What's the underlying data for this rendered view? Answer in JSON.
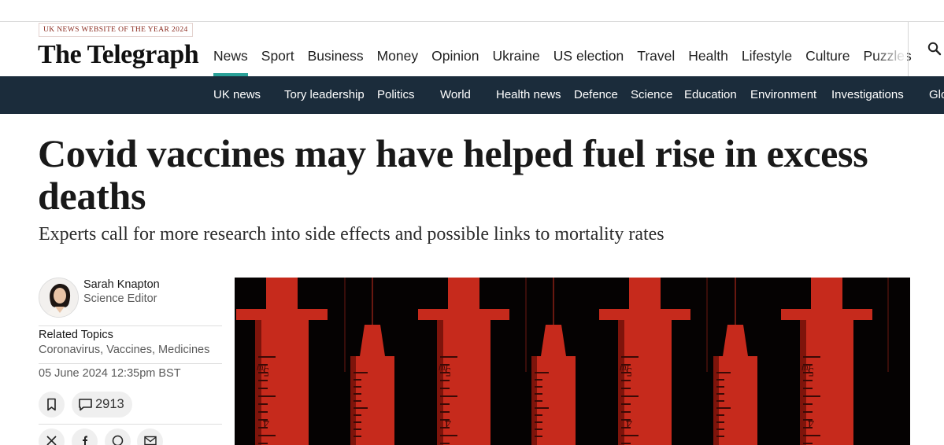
{
  "masthead": {
    "award": "UK NEWS WEBSITE OF THE YEAR 2024",
    "logo": "The Telegraph"
  },
  "primary_nav": {
    "items": [
      "News",
      "Sport",
      "Business",
      "Money",
      "Opinion",
      "Ukraine",
      "US election",
      "Travel",
      "Health",
      "Lifestyle",
      "Culture",
      "Puzzles"
    ],
    "active": "News",
    "accent": "#2aa198"
  },
  "icons": {
    "search": "search-icon",
    "bookmark": "bookmark-icon",
    "comments": "comment-icon",
    "share": [
      "x-icon",
      "facebook-icon",
      "whatsapp-icon",
      "email-icon"
    ]
  },
  "secondary_nav": {
    "items": [
      "UK news",
      "Tory leadership",
      "Politics",
      "World",
      "Health news",
      "Defence",
      "Science",
      "Education",
      "Environment",
      "Investigations",
      "Glo"
    ],
    "background": "#1b2c3b"
  },
  "article": {
    "headline": "Covid vaccines may have helped fuel rise in excess deaths",
    "standfirst": "Experts call for more research into side effects and possible links to mortality rates",
    "author": {
      "name": "Sarah Knapton",
      "role": "Science Editor"
    },
    "related_label": "Related Topics",
    "related_topics": "Coronavirus, Vaccines, Medicines",
    "date": "05 June 2024 12:35pm BST",
    "comment_count": "2913"
  },
  "hero": {
    "syringe_labels": [
      "ml",
      "5",
      "4"
    ],
    "color": "#c62a1c"
  }
}
